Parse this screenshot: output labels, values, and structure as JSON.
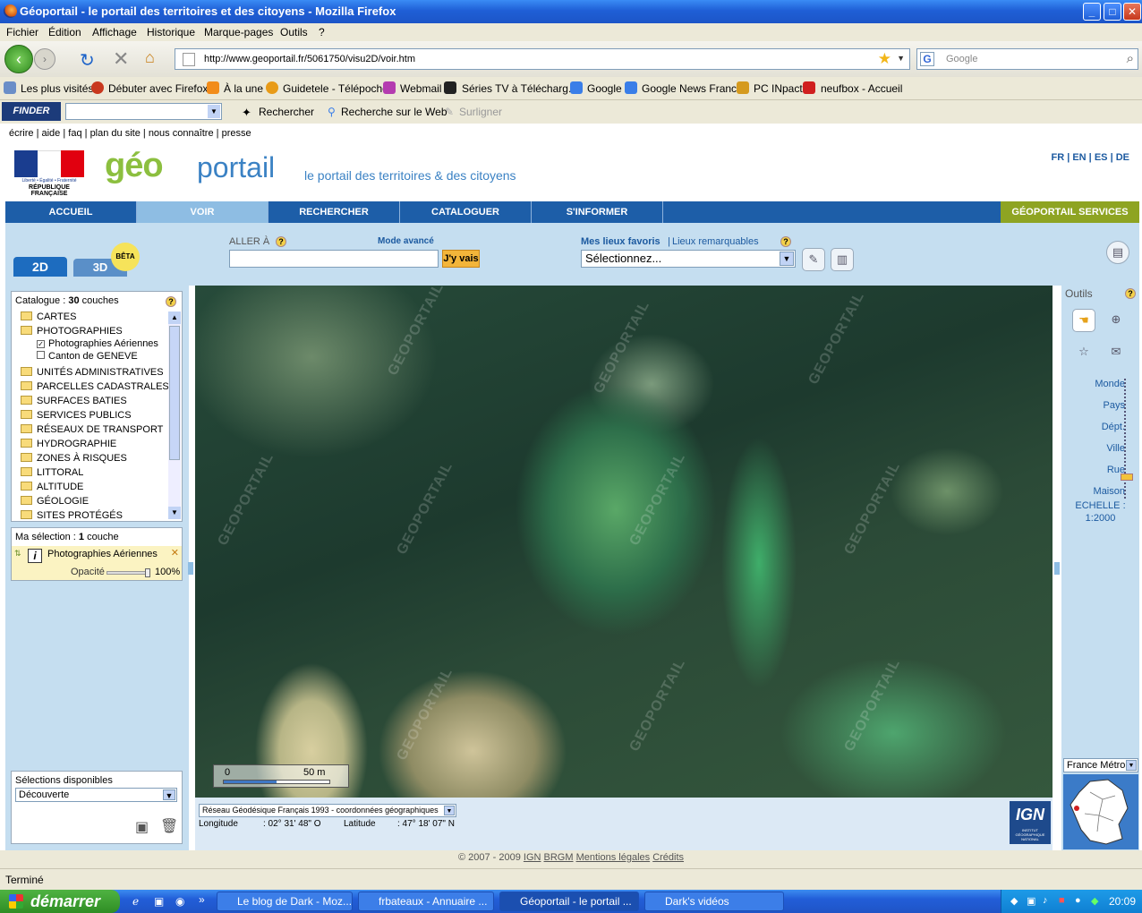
{
  "window": {
    "title": "Géoportail - le portail des territoires et des citoyens - Mozilla Firefox",
    "controls": [
      "_",
      "□",
      "✕"
    ]
  },
  "menu": [
    "Fichier",
    "Édition",
    "Affichage",
    "Historique",
    "Marque-pages",
    "Outils",
    "?"
  ],
  "navbar": {
    "url": "http://www.geoportail.fr/5061750/visu2D/voir.htm",
    "search_placeholder": "Google",
    "search_engine_letter": "G"
  },
  "bookmarks": [
    "Les plus visités",
    "Débuter avec Firefox",
    "À la une",
    "Guidetele - Télépoche",
    "Webmail",
    "Séries TV à Télécharg...",
    "Google",
    "Google News France",
    "PC INpact",
    "neufbox - Accueil"
  ],
  "finderbar": {
    "logo": "FINDER",
    "search_label": "Rechercher",
    "web_search_label": "Recherche sur le Web",
    "highlight_label": "Surligner"
  },
  "page": {
    "toplinks": [
      "écrire",
      "aide",
      "faq",
      "plan du site",
      "nous connaître",
      "presse"
    ],
    "logo_rf": {
      "motto": "Liberté • Égalité • Fraternité",
      "name": "RÉPUBLIQUE FRANÇAISE"
    },
    "logo_geo": "géo",
    "logo_portail": "portail",
    "tagline": "le portail des territoires & des citoyens",
    "langs": [
      "FR",
      "EN",
      "ES",
      "DE"
    ],
    "nav": [
      "ACCUEIL",
      "VOIR",
      "RECHERCHER",
      "CATALOGUER",
      "S'INFORMER"
    ],
    "nav_services": "GÉOPORTAIL SERVICES",
    "tab_2d": "2D",
    "tab_3d": "3D",
    "beta": "BÊTA",
    "aller_a": "ALLER À",
    "mode_avance": "Mode avancé",
    "jyvais": "J'y vais",
    "favoris": "Mes lieux favoris",
    "separator": "|",
    "remarquables": "Lieux remarquables",
    "fav_select": "Sélectionnez...",
    "help": "?"
  },
  "catalog": {
    "label": "Catalogue : ",
    "count": "30",
    "unit": " couches",
    "items": [
      {
        "label": "CARTES",
        "type": "folder"
      },
      {
        "label": "PHOTOGRAPHIES",
        "type": "folder"
      },
      {
        "label": "Photographies Aériennes",
        "type": "checked"
      },
      {
        "label": "Canton de GENEVE",
        "type": "unchecked"
      },
      {
        "label": "UNITÉS ADMINISTRATIVES",
        "type": "folder"
      },
      {
        "label": "PARCELLES CADASTRALES",
        "type": "folder"
      },
      {
        "label": "SURFACES BATIES",
        "type": "folder"
      },
      {
        "label": "SERVICES PUBLICS",
        "type": "folder"
      },
      {
        "label": "RÉSEAUX DE TRANSPORT",
        "type": "folder"
      },
      {
        "label": "HYDROGRAPHIE",
        "type": "folder"
      },
      {
        "label": "ZONES À RISQUES",
        "type": "folder"
      },
      {
        "label": "LITTORAL",
        "type": "folder"
      },
      {
        "label": "ALTITUDE",
        "type": "folder"
      },
      {
        "label": "GÉOLOGIE",
        "type": "folder"
      },
      {
        "label": "SITES PROTÉGÉS",
        "type": "folder"
      }
    ]
  },
  "selection": {
    "label": "Ma sélection : ",
    "count": "1",
    "unit": " couche",
    "layer": "Photographies Aériennes",
    "opacity_label": "Opacité",
    "opacity_value": "100%",
    "opacity": 1.0
  },
  "dispo": {
    "label": "Sélections disponibles",
    "value": "Découverte"
  },
  "map": {
    "watermark": "GEOPORTAIL",
    "scale_start": "0",
    "scale_end": "50 m",
    "projection": "Réseau Géodésique Français 1993 - coordonnées géographiques",
    "lon_label": "Longitude",
    "lon_value": ": 02° 31' 48\" O",
    "lat_label": "Latitude",
    "lat_value": ": 47° 18' 07\" N",
    "ign": "IGN",
    "ign_sub": "INSTITUT GÉOGRAPHIQUE NATIONAL"
  },
  "tools": {
    "title": "Outils",
    "zoom_levels": [
      "Monde",
      "Pays",
      "Dépt.",
      "Ville",
      "Rue",
      "Maison"
    ],
    "echelle_label": "ECHELLE :",
    "echelle_value": "1:2000",
    "region": "France Métrop"
  },
  "footer": {
    "copyright": "© 2007 - 2009",
    "links": [
      "IGN",
      "BRGM",
      "Mentions légales",
      "Crédits"
    ]
  },
  "status": "Terminé",
  "taskbar": {
    "start": "démarrer",
    "tasks": [
      "Le blog de Dark - Moz...",
      "frbateaux - Annuaire ...",
      "Géoportail - le portail ...",
      "Dark's vidéos"
    ],
    "time": "20:09"
  }
}
